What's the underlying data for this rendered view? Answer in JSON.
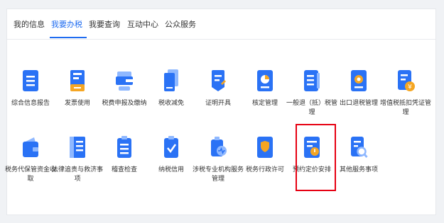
{
  "tabs": [
    {
      "label": "我的信息"
    },
    {
      "label": "我要办税"
    },
    {
      "label": "我要查询"
    },
    {
      "label": "互动中心"
    },
    {
      "label": "公众服务"
    }
  ],
  "active_tab": "我要办税",
  "colors": {
    "accent": "#1f6cf0",
    "icon_blue": "#2a72f5",
    "icon_light": "#8fb8ff",
    "icon_orange": "#f5a623",
    "highlight": "#e60012"
  },
  "services": [
    {
      "label": "综合信息报告",
      "icon": "document-list-icon"
    },
    {
      "label": "发票使用",
      "icon": "invoice-icon"
    },
    {
      "label": "税费申报及缴纳",
      "icon": "wallet-card-icon"
    },
    {
      "label": "税收减免",
      "icon": "stacked-document-icon"
    },
    {
      "label": "证明开具",
      "icon": "certificate-pen-icon"
    },
    {
      "label": "核定管理",
      "icon": "chart-document-icon"
    },
    {
      "label": "一般退（抵）税管理",
      "icon": "refund-list-icon"
    },
    {
      "label": "出口退税管理",
      "icon": "export-refund-icon"
    },
    {
      "label": "增值税抵扣凭证管理",
      "icon": "vat-voucher-icon"
    },
    {
      "label": "税务代保管资金收取",
      "icon": "wallet-icon"
    },
    {
      "label": "法律追责与救济事项",
      "icon": "law-book-icon"
    },
    {
      "label": "稽查检查",
      "icon": "inspection-clipboard-icon"
    },
    {
      "label": "纳税信用",
      "icon": "credit-check-icon"
    },
    {
      "label": "涉税专业机构服务管理",
      "icon": "agency-briefcase-icon"
    },
    {
      "label": "税务行政许可",
      "icon": "shield-permit-icon"
    },
    {
      "label": "预约定价安排",
      "icon": "pricing-appointment-icon"
    },
    {
      "label": "其他服务事项",
      "icon": "search-document-icon"
    }
  ],
  "highlighted_service": "预约定价安排"
}
